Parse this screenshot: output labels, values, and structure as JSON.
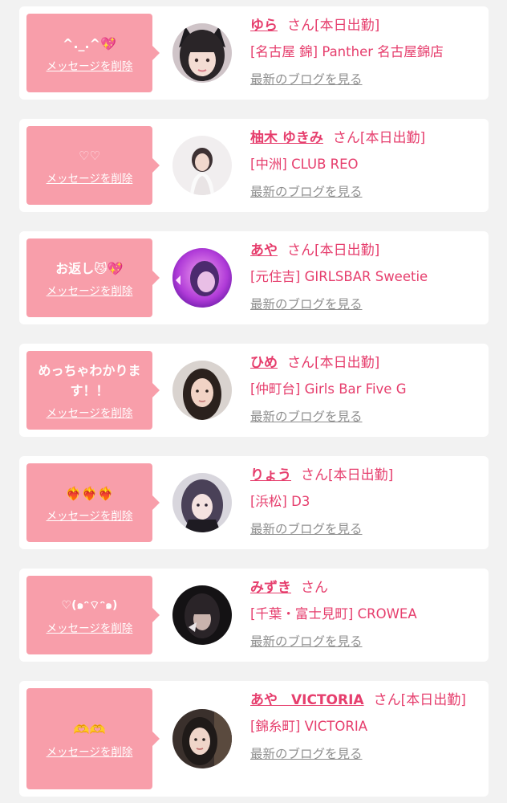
{
  "colors": {
    "background": "#f2f2f2",
    "card": "#ffffff",
    "bubble": "#f89eaa",
    "accent_pink": "#e63e6d",
    "link_gray": "#8f8f8f"
  },
  "common": {
    "delete_label": "メッセージを削除",
    "san": "さん",
    "blog_link": "最新のブログを見る",
    "on_duty": "[本日出勤]"
  },
  "cards": [
    {
      "message": "^._.^💖",
      "name": "ゆら",
      "status": "[本日出勤]",
      "shop": "[名古屋 錦] Panther 名古屋錦店"
    },
    {
      "message": "♡♡",
      "name": "柚木 ゆきみ",
      "status": "[本日出勤]",
      "shop": "[中洲] CLUB REO"
    },
    {
      "message": "お返し😼💖",
      "name": "あや",
      "status": "[本日出勤]",
      "shop": "[元住吉] GIRLSBAR Sweetie"
    },
    {
      "message": "めっちゃわかります！！",
      "name": "ひめ",
      "status": "[本日出勤]",
      "shop": "[仲町台] Girls Bar Five G"
    },
    {
      "message": "❤️‍🔥❤️‍🔥❤️‍🔥",
      "name": "りょう",
      "status": "[本日出勤]",
      "shop": "[浜松] D3"
    },
    {
      "message": "♡(๑ᵔ⌔ᵔ๑)",
      "name": "みずき",
      "status": "",
      "shop": "[千葉・富士見町] CROWEA"
    },
    {
      "message": "🫶🫶",
      "name": "あや　VICTORIA",
      "status": "[本日出勤]",
      "shop": "[錦糸町] VICTORIA"
    }
  ]
}
